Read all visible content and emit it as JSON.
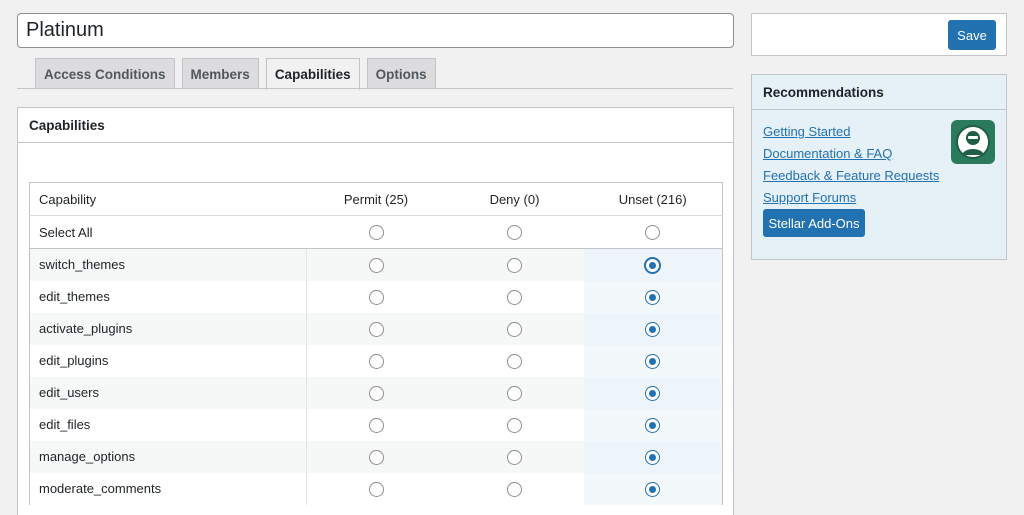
{
  "title": {
    "value": "Platinum"
  },
  "tabs": [
    "Access Conditions",
    "Members",
    "Capabilities",
    "Options"
  ],
  "panel": {
    "title": "Capabilities"
  },
  "table": {
    "headers": [
      "Capability",
      "Permit (25)",
      "Deny (0)",
      "Unset (216)"
    ],
    "select_all_label": "Select All",
    "rows": [
      "switch_themes",
      "edit_themes",
      "activate_plugins",
      "edit_plugins",
      "edit_users",
      "edit_files",
      "manage_options",
      "moderate_comments"
    ]
  },
  "sidebar": {
    "save_label": "Save",
    "recommendations_title": "Recommendations",
    "links": [
      "Getting Started",
      "Documentation & FAQ",
      "Feedback & Feature Requests",
      "Support Forums"
    ],
    "addons_label": "Stellar Add-Ons"
  },
  "colors": {
    "accent": "#2271b1",
    "unset_column": "#eef5fa",
    "recommendations_bg": "#e5f0f7"
  }
}
